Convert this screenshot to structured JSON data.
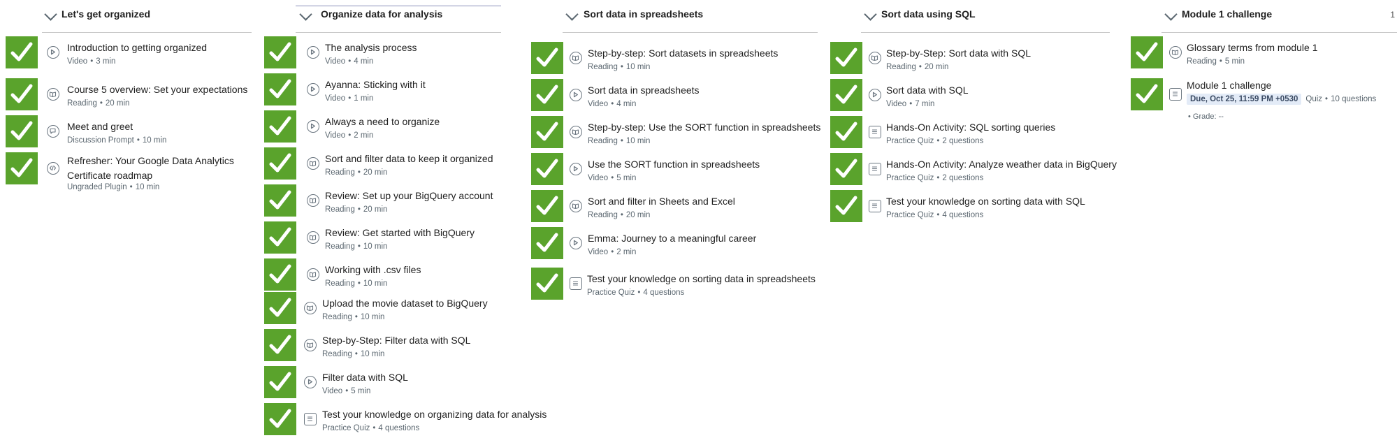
{
  "colors": {
    "check_green": "#5aa32c",
    "icon_gray": "#6b7680",
    "meta_gray": "#5b6770",
    "due_bg": "#e3ebf7"
  },
  "sections": [
    {
      "title": "Let's get organized",
      "count": "",
      "items": [
        {
          "title": "Introduction to getting organized",
          "type": "Video",
          "detail": "3 min",
          "icon": "play-icon"
        },
        {
          "title": "Course 5 overview: Set your expectations",
          "type": "Reading",
          "detail": "20 min",
          "icon": "book-icon"
        },
        {
          "title": "Meet and greet",
          "type": "Discussion Prompt",
          "detail": "10 min",
          "icon": "chat-icon"
        },
        {
          "title": "Refresher: Your Google Data Analytics Certificate roadmap",
          "type": "Ungraded Plugin",
          "detail": "10 min",
          "icon": "code-icon"
        }
      ]
    },
    {
      "title": "Organize data for analysis",
      "count": "",
      "items": [
        {
          "title": "The analysis process",
          "type": "Video",
          "detail": "4 min",
          "icon": "play-icon"
        },
        {
          "title": "Ayanna: Sticking with it",
          "type": "Video",
          "detail": "1 min",
          "icon": "play-icon"
        },
        {
          "title": "Always a need to organize",
          "type": "Video",
          "detail": "2 min",
          "icon": "play-icon"
        },
        {
          "title": "Sort and filter data to keep it organized",
          "type": "Reading",
          "detail": "20 min",
          "icon": "book-icon"
        },
        {
          "title": "Review: Set up your BigQuery account",
          "type": "Reading",
          "detail": "20 min",
          "icon": "book-icon"
        },
        {
          "title": "Review: Get started with BigQuery",
          "type": "Reading",
          "detail": "10 min",
          "icon": "book-icon"
        },
        {
          "title": "Working with .csv files",
          "type": "Reading",
          "detail": "10 min",
          "icon": "book-icon"
        },
        {
          "title": "Upload the movie dataset to BigQuery",
          "type": "Reading",
          "detail": "10 min",
          "icon": "book-icon"
        },
        {
          "title": "Step-by-Step: Filter data with SQL",
          "type": "Reading",
          "detail": "10 min",
          "icon": "book-icon"
        },
        {
          "title": "Filter data with SQL",
          "type": "Video",
          "detail": "5 min",
          "icon": "play-icon"
        },
        {
          "title": "Test your knowledge on organizing data for analysis",
          "type": "Practice Quiz",
          "detail": "4 questions",
          "icon": "quiz-icon"
        }
      ]
    },
    {
      "title": "Sort data in spreadsheets",
      "count": "",
      "items": [
        {
          "title": "Step-by-step: Sort datasets in spreadsheets",
          "type": "Reading",
          "detail": "10 min",
          "icon": "book-icon"
        },
        {
          "title": "Sort data in spreadsheets",
          "type": "Video",
          "detail": "4 min",
          "icon": "play-icon"
        },
        {
          "title": "Step-by-step: Use the SORT function in spreadsheets",
          "type": "Reading",
          "detail": "10 min",
          "icon": "book-icon"
        },
        {
          "title": "Use the SORT function in spreadsheets",
          "type": "Video",
          "detail": "5 min",
          "icon": "play-icon"
        },
        {
          "title": "Sort and filter in Sheets and Excel",
          "type": "Reading",
          "detail": "20 min",
          "icon": "book-icon"
        },
        {
          "title": "Emma: Journey to a meaningful career",
          "type": "Video",
          "detail": "2 min",
          "icon": "play-icon"
        },
        {
          "title": "Test your knowledge on sorting data in spreadsheets",
          "type": "Practice Quiz",
          "detail": "4 questions",
          "icon": "quiz-icon"
        }
      ]
    },
    {
      "title": "Sort data using SQL",
      "count": "",
      "items": [
        {
          "title": "Step-by-Step: Sort data with SQL",
          "type": "Reading",
          "detail": "20 min",
          "icon": "book-icon"
        },
        {
          "title": "Sort data with SQL",
          "type": "Video",
          "detail": "7 min",
          "icon": "play-icon"
        },
        {
          "title": "Hands-On Activity: SQL sorting queries",
          "type": "Practice Quiz",
          "detail": "2 questions",
          "icon": "quiz-icon"
        },
        {
          "title": "Hands-On Activity: Analyze weather data in BigQuery",
          "type": "Practice Quiz",
          "detail": "2 questions",
          "icon": "quiz-icon"
        },
        {
          "title": "Test your knowledge on sorting data with SQL",
          "type": "Practice Quiz",
          "detail": "4 questions",
          "icon": "quiz-icon"
        }
      ]
    },
    {
      "title": "Module 1 challenge",
      "count": "1",
      "items": [
        {
          "title": "Glossary terms from module 1",
          "type": "Reading",
          "detail": "5 min",
          "icon": "book-icon"
        },
        {
          "title": "Module 1 challenge",
          "due": "Due, Oct 25, 11:59 PM +0530",
          "type": "Quiz",
          "detail": "10 questions",
          "grade": "Grade: --",
          "icon": "quiz-icon"
        }
      ]
    }
  ]
}
